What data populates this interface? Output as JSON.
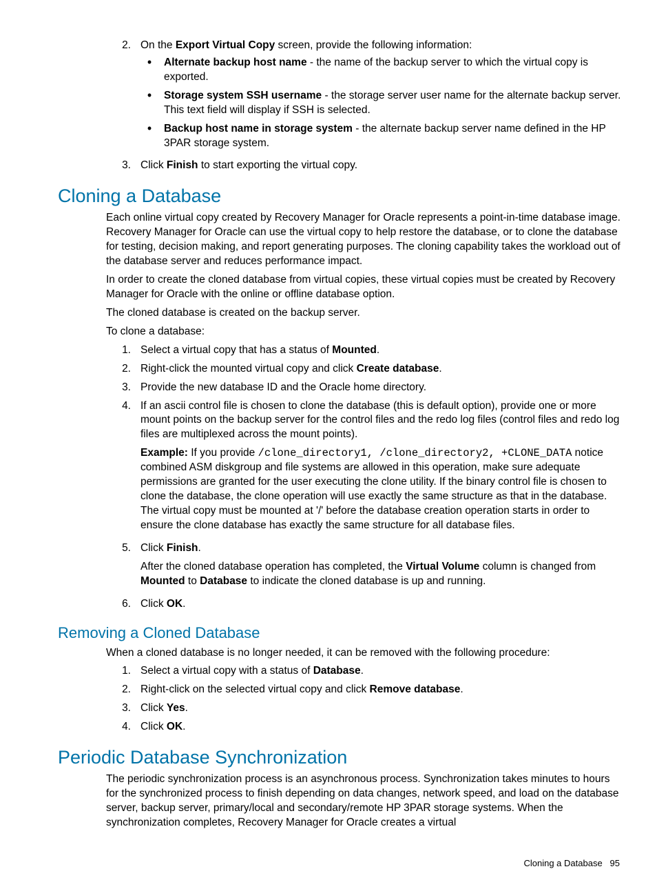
{
  "topList": {
    "item2_pre": "On the ",
    "item2_bold": "Export Virtual Copy",
    "item2_post": " screen, provide the following information:",
    "bullet1_bold": "Alternate backup host name",
    "bullet1_rest": " - the name of the backup server to which the virtual copy is exported.",
    "bullet2_bold": "Storage system SSH username",
    "bullet2_rest": " - the storage server user name for the alternate backup server. This text field will display if SSH is selected.",
    "bullet3_bold": "Backup host name in storage system",
    "bullet3_rest": " - the alternate backup server name defined in the HP 3PAR storage system.",
    "item3_pre": "Click ",
    "item3_bold": "Finish",
    "item3_post": " to start exporting the virtual copy."
  },
  "cloning": {
    "heading": "Cloning a Database",
    "p1": "Each online virtual copy created by Recovery Manager for Oracle represents a point-in-time database image. Recovery Manager for Oracle can use the virtual copy to help restore the database, or to clone the database for testing, decision making, and report generating purposes. The cloning capability takes the workload out of the database server and reduces performance impact.",
    "p2": "In order to create the cloned database from virtual copies, these virtual copies must be created by Recovery Manager for Oracle with the online or offline database option.",
    "p3": "The cloned database is created on the backup server.",
    "p4": "To clone a database:",
    "s1_pre": "Select a virtual copy that has a status of ",
    "s1_bold": "Mounted",
    "s1_post": ".",
    "s2_pre": "Right-click the mounted virtual copy and click ",
    "s2_bold": "Create database",
    "s2_post": ".",
    "s3": "Provide the new database ID and the Oracle home directory.",
    "s4": "If an ascii control file is chosen to clone the database (this is default option), provide one or more mount points on the backup server for the control files and the redo log files (control files and redo log files are multiplexed across the mount points).",
    "s4_ex_label": "Example:",
    "s4_ex_pre": " If you provide ",
    "s4_ex_code": "/clone_directory1, /clone_directory2, +CLONE_DATA",
    "s4_ex_rest": " notice combined ASM diskgroup and file systems are allowed in this operation, make sure adequate permissions are granted for the user executing the clone utility. If the binary control file is chosen to clone the database, the clone operation will use exactly the same structure as that in the database. The virtual copy must be mounted at '/' before the database creation operation starts in order to ensure the clone database has exactly the same structure for all database files.",
    "s5_pre": "Click ",
    "s5_bold": "Finish",
    "s5_post": ".",
    "s5_sub_pre": "After the cloned database operation has completed, the ",
    "s5_sub_b1": "Virtual Volume",
    "s5_sub_mid": " column is changed from ",
    "s5_sub_b2": "Mounted",
    "s5_sub_mid2": " to ",
    "s5_sub_b3": "Database",
    "s5_sub_post": " to indicate the cloned database is up and running.",
    "s6_pre": "Click ",
    "s6_bold": "OK",
    "s6_post": "."
  },
  "removing": {
    "heading": "Removing a Cloned Database",
    "p1": "When a cloned database is no longer needed, it can be removed with the following procedure:",
    "s1_pre": "Select a virtual copy with a status of ",
    "s1_bold": "Database",
    "s1_post": ".",
    "s2_pre": "Right-click on the selected virtual copy and click ",
    "s2_bold": "Remove database",
    "s2_post": ".",
    "s3_pre": "Click ",
    "s3_bold": "Yes",
    "s3_post": ".",
    "s4_pre": "Click ",
    "s4_bold": "OK",
    "s4_post": "."
  },
  "periodic": {
    "heading": "Periodic Database Synchronization",
    "p1": "The periodic synchronization process is an asynchronous process. Synchronization takes minutes to hours for the synchronized process to finish depending on data changes, network speed, and load on the database server, backup server, primary/local and secondary/remote HP 3PAR storage systems. When the synchronization completes, Recovery Manager for Oracle creates a virtual"
  },
  "footer": {
    "label": "Cloning a Database",
    "page": "95"
  }
}
